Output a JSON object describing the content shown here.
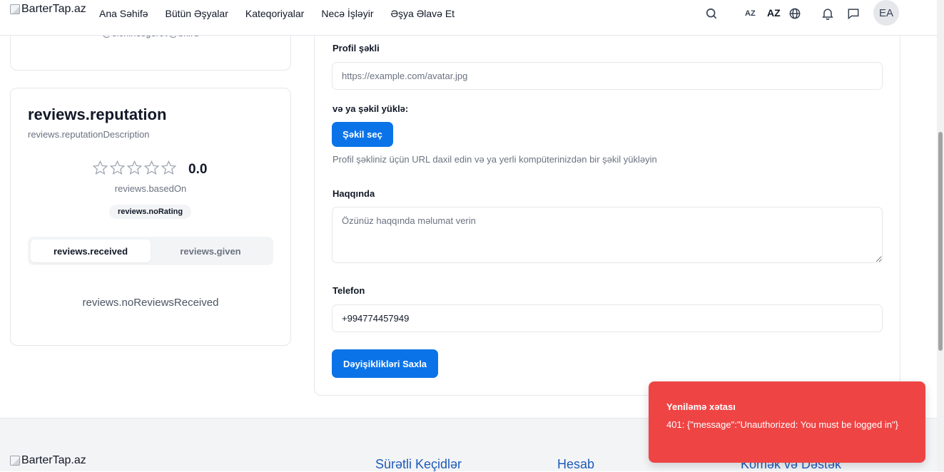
{
  "header": {
    "logo_alt": "BarterTap.az",
    "nav": [
      "Ana Səhifə",
      "Bütün Əşyalar",
      "Kateqoriyalar",
      "Necə İşləyir",
      "Əşya Əlavə Et"
    ],
    "lang_small": "AZ",
    "lang_big": "AZ",
    "avatar_initials": "EA",
    "icons": [
      "search-icon",
      "globe-icon",
      "bell-icon",
      "chat-icon"
    ]
  },
  "profile_card": {
    "cut_text": "@elchinesgerov@bk.ru"
  },
  "reputation": {
    "title": "reviews.reputation",
    "description": "reviews.reputationDescription",
    "rating_value": "0.0",
    "stars_filled": 0,
    "stars_total": 5,
    "based_on": "reviews.basedOn",
    "no_rating_badge": "reviews.noRating",
    "tabs": [
      "reviews.received",
      "reviews.given"
    ],
    "active_tab": "reviews.received",
    "empty_message": "reviews.noReviewsReceived"
  },
  "form": {
    "avatar_label": "Profil şəkli",
    "avatar_placeholder": "https://example.com/avatar.jpg",
    "upload_label": "və ya şəkil yüklə:",
    "upload_button": "Şəkil seç",
    "upload_helper": "Profil şəkliniz üçün URL daxil edin və ya yerli kompüterinizdən bir şəkil yükləyin",
    "about_label": "Haqqında",
    "about_placeholder": "Özünüz haqqında məlumat verin",
    "phone_label": "Telefon",
    "phone_value": "+994774457949",
    "save_button": "Dəyişiklikləri Saxla"
  },
  "footer": {
    "logo_alt": "BarterTap.az",
    "headings": [
      "Sürətli Keçidlər",
      "Hesab",
      "Kömək və Dəstək"
    ]
  },
  "toast": {
    "title": "Yeniləmə xətası",
    "message": "401: {\"message\":\"Unauthorized: You must be logged in\"}",
    "color": "#ef4444"
  },
  "colors": {
    "accent": "#0b73e8",
    "footer_heading": "#1e5bb8"
  }
}
